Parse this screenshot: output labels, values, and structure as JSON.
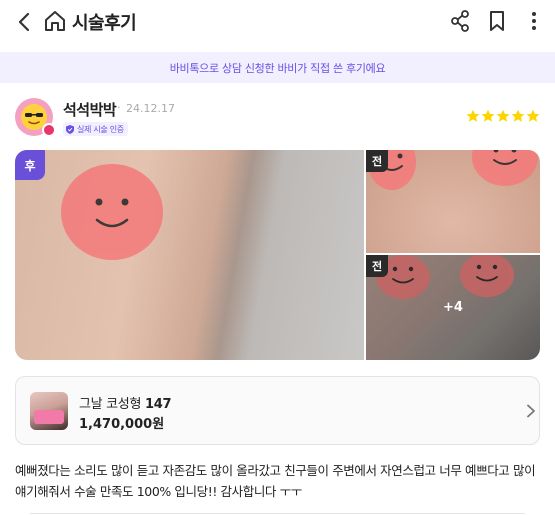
{
  "header": {
    "title": "시술후기",
    "icons": [
      "back-icon",
      "home-icon",
      "share-icon",
      "bookmark-icon",
      "more-icon"
    ]
  },
  "notice": {
    "text": "바비톡으로 상담 신청한 바비가 직접 쓴 후기에요"
  },
  "review": {
    "author": "석석박박",
    "separator": "·",
    "date": "24.12.17",
    "verified_label": "실제 시술 인증",
    "rating": 5,
    "photos": {
      "after_tag": "후",
      "before_tag": "전",
      "more_count": "+4"
    },
    "body": "예뻐졌다는 소리도 많이 듣고 자존감도 많이 올라갔고 친구들이 주변에서 자연스럽고 너무 예쁘다고 많이 얘기해줘서 수술 만족도 100% 입니당!! 감사합니다 ㅜㅜ"
  },
  "product": {
    "name_prefix": "그날 코성형",
    "name_number": "147",
    "price": "1,470,000원"
  },
  "colors": {
    "accent": "#6a4fd8",
    "star": "#ffd400",
    "notice_bg": "#f2f0ff"
  }
}
